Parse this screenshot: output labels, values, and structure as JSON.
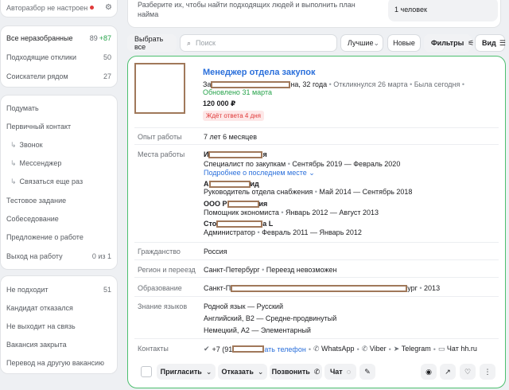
{
  "sidebar": {
    "autoparse": "Авторазбор не настроен",
    "filters": [
      {
        "label": "Все неразобранные",
        "count": "89",
        "plus": "+87"
      },
      {
        "label": "Подходящие отклики",
        "count": "50"
      },
      {
        "label": "Соискатели рядом",
        "count": "27"
      }
    ],
    "stages": [
      {
        "label": "Подумать"
      },
      {
        "label": "Первичный контакт"
      },
      {
        "label": "Звонок",
        "sub": true
      },
      {
        "label": "Мессенджер",
        "sub": true
      },
      {
        "label": "Связаться еще раз",
        "sub": true
      },
      {
        "label": "Тестовое задание"
      },
      {
        "label": "Собеседование"
      },
      {
        "label": "Предложение о работе"
      },
      {
        "label": "Выход на работу",
        "count": "0 из 1"
      }
    ],
    "reject": [
      {
        "label": "Не подходит",
        "count": "51"
      },
      {
        "label": "Кандидат отказался"
      },
      {
        "label": "Не выходит на связь"
      },
      {
        "label": "Вакансия закрыта"
      },
      {
        "label": "Перевод на другую вакансию"
      }
    ]
  },
  "hint": {
    "text": "Разберите их, чтобы найти подходящих людей и выполнить план найма",
    "people": "1 человек"
  },
  "toolbar": {
    "select_all": "Выбрать все",
    "search_placeholder": "Поиск",
    "sort": "Лучшие",
    "new": "Новые",
    "filters": "Фильтры",
    "view": "Вид"
  },
  "card": {
    "title": "Менеджер отдела закупок",
    "name_prefix": "За",
    "age": "на, 32 года",
    "responded": "Откликнулся 26 марта",
    "seen": "Была сегодня",
    "updated": "Обновлено 31 марта",
    "salary": "120 000 ₽",
    "wait_badge": "Ждёт ответа 4 дня",
    "experience_label": "Опыт работы",
    "experience_value": "7 лет 6 месяцев",
    "workplaces_label": "Места работы",
    "jobs": [
      {
        "company_a": "И",
        "company_b": "я",
        "role": "Специалист по закупкам",
        "period": "Сентябрь 2019 — Февраль 2020",
        "more": "Подробнее о последнем месте"
      },
      {
        "company_a": "А",
        "company_b": "ид",
        "role": "Руководитель отдела снабжения",
        "period": "Май 2014 — Сентябрь 2018"
      },
      {
        "company_a": "ООО Р",
        "company_b": "ия",
        "role": "Помощник экономиста",
        "period": "Январь 2012 — Август 2013"
      },
      {
        "company_a": "Сто",
        "company_b": "а L",
        "role": "Администратор",
        "period": "Февраль 2011 — Январь 2012"
      }
    ],
    "citizenship_label": "Гражданство",
    "citizenship_value": "Россия",
    "region_label": "Регион и переезд",
    "region_city": "Санкт-Петербург",
    "region_move": "Переезд невозможен",
    "education_label": "Образование",
    "education_a": "Санкт-П",
    "education_b": "ург",
    "education_year": "2013",
    "languages_label": "Знание языков",
    "languages": [
      "Родной язык — Русский",
      "Английский, B2 — Средне-продвинутый",
      "Немецкий, A2 — Элементарный"
    ],
    "contacts_label": "Контакты",
    "phone_prefix": "+7 (91",
    "show_phone": "ать телефон",
    "whatsapp": "WhatsApp",
    "viber": "Viber",
    "telegram": "Telegram",
    "chat_hh": "Чат hh.ru",
    "actions": {
      "invite": "Пригласить",
      "reject": "Отказать",
      "call": "Позвонить",
      "chat": "Чат"
    }
  }
}
